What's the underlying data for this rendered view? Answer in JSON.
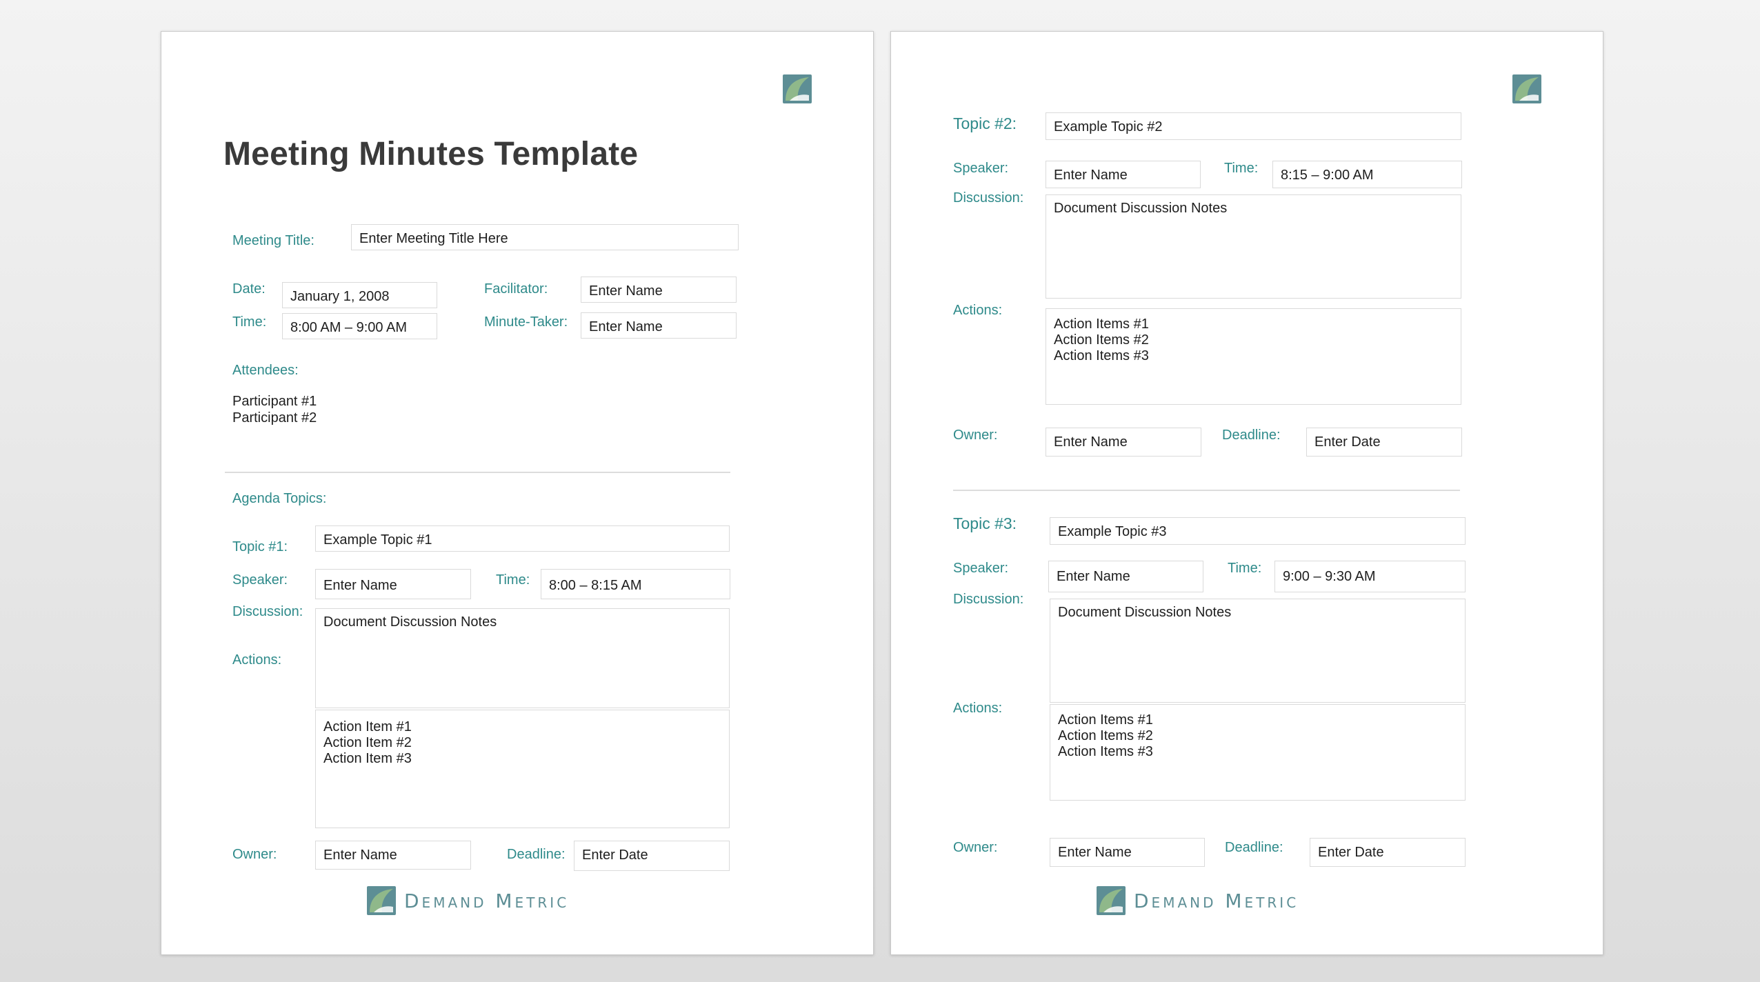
{
  "brand": {
    "name": "Demand Metric",
    "accent": "#2e8a8a",
    "logo_green": "#8fb88a",
    "logo_teal": "#5d8e95"
  },
  "page1": {
    "title": "Meeting Minutes Template",
    "meeting_title": {
      "label": "Meeting Title:",
      "value": "Enter Meeting Title Here"
    },
    "date": {
      "label": "Date:",
      "value": "January 1, 2008"
    },
    "time": {
      "label": "Time:",
      "value": "8:00 AM – 9:00 AM"
    },
    "facilitator": {
      "label": "Facilitator:",
      "value": "Enter Name"
    },
    "minute_taker": {
      "label": "Minute-Taker:",
      "value": "Enter Name"
    },
    "attendees": {
      "label": "Attendees:",
      "items": [
        "Participant #1",
        "Participant #2"
      ]
    },
    "agenda_label": "Agenda Topics:",
    "topic1": {
      "label": "Topic #1:",
      "value": "Example Topic #1",
      "speaker_label": "Speaker:",
      "speaker": "Enter Name",
      "time_label": "Time:",
      "time": "8:00 – 8:15 AM",
      "discussion_label": "Discussion:",
      "discussion": "Document Discussion Notes",
      "actions_label": "Actions:",
      "actions": [
        "Action Item #1",
        "Action Item #2",
        "Action Item #3"
      ],
      "owner_label": "Owner:",
      "owner": "Enter Name",
      "deadline_label": "Deadline:",
      "deadline": "Enter Date"
    }
  },
  "page2": {
    "topic2": {
      "label": "Topic #2:",
      "value": "Example Topic #2",
      "speaker_label": "Speaker:",
      "speaker": "Enter Name",
      "time_label": "Time:",
      "time": "8:15 – 9:00 AM",
      "discussion_label": "Discussion:",
      "discussion": "Document Discussion Notes",
      "actions_label": "Actions:",
      "actions": [
        "Action Items #1",
        "Action Items #2",
        "Action Items #3"
      ],
      "owner_label": "Owner:",
      "owner": "Enter Name",
      "deadline_label": "Deadline:",
      "deadline": "Enter Date"
    },
    "topic3": {
      "label": "Topic #3:",
      "value": "Example Topic #3",
      "speaker_label": "Speaker:",
      "speaker": "Enter Name",
      "time_label": "Time:",
      "time": "9:00 – 9:30 AM",
      "discussion_label": "Discussion:",
      "discussion": "Document Discussion Notes",
      "actions_label": "Actions:",
      "actions": [
        "Action Items #1",
        "Action Items #2",
        "Action Items #3"
      ],
      "owner_label": "Owner:",
      "owner": "Enter Name",
      "deadline_label": "Deadline:",
      "deadline": "Enter Date"
    }
  }
}
